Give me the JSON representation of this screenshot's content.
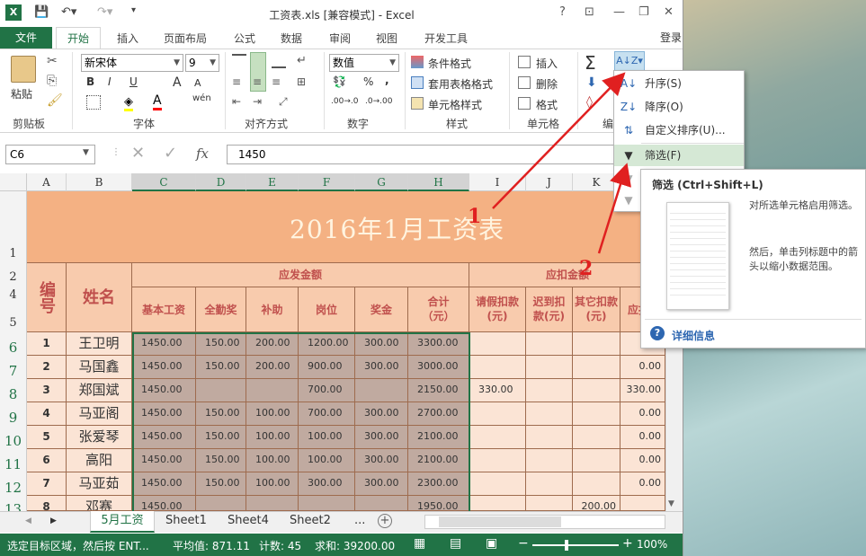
{
  "window": {
    "title": "工资表.xls  [兼容模式] - Excel",
    "help": "?",
    "login": "登录"
  },
  "tabs": [
    "文件",
    "开始",
    "插入",
    "页面布局",
    "公式",
    "数据",
    "审阅",
    "视图",
    "开发工具"
  ],
  "ribbon": {
    "clipboard": {
      "paste": "粘贴",
      "label": "剪贴板"
    },
    "font": {
      "name": "新宋体",
      "size": "9",
      "label": "字体",
      "bold": "B",
      "italic": "I",
      "underline": "U",
      "grow": "A",
      "shrink": "A",
      "wen": "wén"
    },
    "align": {
      "label": "对齐方式"
    },
    "number": {
      "format": "数值",
      "label": "数字",
      "pct": "%",
      "comma": ",",
      "dec_inc": ".00→.0",
      "dec_dec": ".0→.00"
    },
    "styles": {
      "cond": "条件格式",
      "table": "套用表格格式",
      "cell": "单元格样式",
      "label": "样式"
    },
    "cells": {
      "insert": "插入",
      "delete": "删除",
      "format": "格式",
      "label": "单元格"
    },
    "edit": {
      "label": "编"
    }
  },
  "formula": {
    "namebox": "C6",
    "fx": "fx",
    "value": "1450"
  },
  "columns": [
    "A",
    "B",
    "C",
    "D",
    "E",
    "F",
    "G",
    "H",
    "I",
    "J",
    "K"
  ],
  "rows": [
    "1",
    "2",
    "4",
    "5",
    "6",
    "7",
    "8",
    "9",
    "10",
    "11",
    "12",
    "13"
  ],
  "sheet": {
    "title": "2016年1月工资表",
    "h_id": "编号",
    "h_name": "姓名",
    "h_pay": "应发金额",
    "h_deduct": "应扣金额",
    "pay_cols": [
      "基本工资",
      "全勤奖",
      "补助",
      "岗位",
      "奖金",
      "合计（元）"
    ],
    "deduct_cols": [
      "请假扣款(元)",
      "迟到扣款(元)",
      "其它扣款(元)",
      "应扣"
    ],
    "data": [
      {
        "no": "1",
        "name": "王卫明",
        "c": "1450.00",
        "d": "150.00",
        "e": "200.00",
        "f": "1200.00",
        "g": "300.00",
        "h": "3300.00",
        "i": "",
        "k": "",
        "l": ""
      },
      {
        "no": "2",
        "name": "马国鑫",
        "c": "1450.00",
        "d": "150.00",
        "e": "200.00",
        "f": "900.00",
        "g": "300.00",
        "h": "3000.00",
        "i": "",
        "k": "",
        "l": "0.00"
      },
      {
        "no": "3",
        "name": "郑国斌",
        "c": "1450.00",
        "d": "",
        "e": "",
        "f": "700.00",
        "g": "",
        "h": "2150.00",
        "i": "330.00",
        "k": "",
        "l": "330.00"
      },
      {
        "no": "4",
        "name": "马亚阁",
        "c": "1450.00",
        "d": "150.00",
        "e": "100.00",
        "f": "700.00",
        "g": "300.00",
        "h": "2700.00",
        "i": "",
        "k": "",
        "l": "0.00"
      },
      {
        "no": "5",
        "name": "张爱琴",
        "c": "1450.00",
        "d": "150.00",
        "e": "100.00",
        "f": "100.00",
        "g": "300.00",
        "h": "2100.00",
        "i": "",
        "k": "",
        "l": "0.00"
      },
      {
        "no": "6",
        "name": "高阳",
        "c": "1450.00",
        "d": "150.00",
        "e": "100.00",
        "f": "100.00",
        "g": "300.00",
        "h": "2100.00",
        "i": "",
        "k": "",
        "l": "0.00"
      },
      {
        "no": "7",
        "name": "马亚茹",
        "c": "1450.00",
        "d": "150.00",
        "e": "100.00",
        "f": "300.00",
        "g": "300.00",
        "h": "2300.00",
        "i": "",
        "k": "",
        "l": "0.00"
      },
      {
        "no": "8",
        "name": "邓赛",
        "c": "1450.00",
        "d": "",
        "e": "",
        "f": "",
        "g": "",
        "h": "1950.00",
        "i": "",
        "k": "200.00",
        "l": ""
      }
    ]
  },
  "sheets": [
    "5月工资",
    "Sheet1",
    "Sheet4",
    "Sheet2",
    "..."
  ],
  "status": {
    "msg": "选定目标区域，然后按 ENT...",
    "avg": "平均值: 871.11",
    "count": "计数: 45",
    "sum": "求和: 39200.00",
    "zoom": "100%"
  },
  "sort_menu": {
    "asc": "升序(S)",
    "desc": "降序(O)",
    "custom": "自定义排序(U)...",
    "filter": "筛选(F)"
  },
  "tooltip": {
    "title": "筛选 (Ctrl+Shift+L)",
    "desc1": "对所选单元格启用筛选。",
    "desc2": "然后，单击列标题中的箭头以缩小数据范围。",
    "more": "详细信息"
  },
  "annotations": {
    "n1": "1",
    "n2": "2"
  },
  "colors": {
    "accent": "#217346",
    "header_bg": "#f4b183",
    "cell_bg": "#fbe4d5",
    "selected_bg": "#c0aaa0",
    "arrow": "#e02020"
  }
}
